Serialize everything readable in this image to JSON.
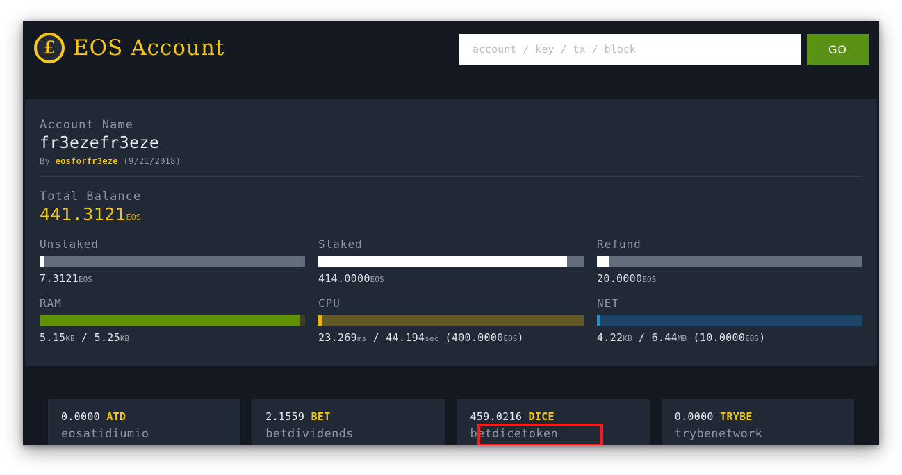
{
  "header": {
    "logo_glyph": "£",
    "brand_title": "EOS Account",
    "search_placeholder": "account / key / tx / block",
    "search_value": "",
    "go_label": "GO"
  },
  "account": {
    "name_label": "Account Name",
    "name": "fr3ezefr3eze",
    "creator_prefix": "By",
    "creator": "eosforfr3eze",
    "created_date": "(9/21/2018)",
    "balance_label": "Total Balance",
    "balance_value": "441.3121",
    "balance_unit": "EOS"
  },
  "resources": [
    {
      "title": "Unstaked",
      "fill_percent": 1.9,
      "fill_color": "#ffffff",
      "track_color": "#636d7c",
      "caption_value": "7.3121",
      "caption_unit": "EOS",
      "caption_suffix": ""
    },
    {
      "title": "Staked",
      "fill_percent": 93.8,
      "fill_color": "#ffffff",
      "track_color": "#636d7c",
      "caption_value": "414.0000",
      "caption_unit": "EOS",
      "caption_suffix": ""
    },
    {
      "title": "Refund",
      "fill_percent": 4.5,
      "fill_color": "#ffffff",
      "track_color": "#636d7c",
      "caption_value": "20.0000",
      "caption_unit": "EOS",
      "caption_suffix": ""
    }
  ],
  "resources2": [
    {
      "title": "RAM",
      "fill_percent": 98.1,
      "fill_color": "#5f9103",
      "track_color": "#3c3f22",
      "used_value": "5.15",
      "used_unit": "KB",
      "total_value": "5.25",
      "total_unit": "KB",
      "extra": ""
    },
    {
      "title": "CPU",
      "fill_percent": 1.6,
      "fill_color": "#f0b400",
      "track_color": "#625a22",
      "used_value": "23.269",
      "used_unit": "ms",
      "total_value": "44.194",
      "total_unit": "sec",
      "extra_value": "(400.0000",
      "extra_unit": "EOS",
      "extra_close": ")"
    },
    {
      "title": "NET",
      "fill_percent": 1.2,
      "fill_color": "#1d90d4",
      "track_color": "#1d4668",
      "used_value": "4.22",
      "used_unit": "KB",
      "total_value": "6.44",
      "total_unit": "MB",
      "extra_value": "(10.0000",
      "extra_unit": "EOS",
      "extra_close": ")"
    }
  ],
  "tokens": [
    {
      "amount": "0.0000",
      "symbol": "ATD",
      "contract": "eosatidiumio"
    },
    {
      "amount": "2.1559",
      "symbol": "BET",
      "contract": "betdividends"
    },
    {
      "amount": "459.0216",
      "symbol": "DICE",
      "contract": "betdicetoken"
    },
    {
      "amount": "0.0000",
      "symbol": "TRYBE",
      "contract": "trybenetwork"
    }
  ],
  "annotation": {
    "highlight_color": "#fc1b1b",
    "highlight_target": "betdicetoken"
  },
  "colors": {
    "page_background": "#ffffff",
    "shell_background": "#141820",
    "card_background": "#212936",
    "accent_gold": "#f5c518",
    "go_green": "#5a9216",
    "muted_text": "#8d96a3"
  }
}
